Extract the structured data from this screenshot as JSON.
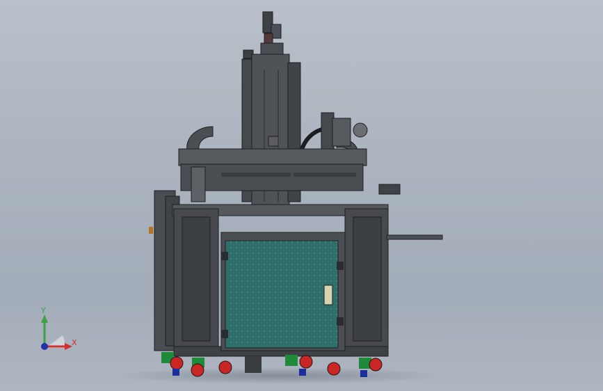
{
  "viewport": {
    "background_top": "#b9c0c9",
    "background_bottom": "#a2acb8"
  },
  "model": {
    "frame_color": "#4a4d52",
    "panel_color": "#2f6f6b",
    "caster_colors": [
      "#1f8a3a",
      "#c92626",
      "#1a2f9a"
    ]
  },
  "triad": {
    "x_label": "X",
    "y_label": "Y",
    "x_color": "#d23030",
    "y_color": "#3fa04a",
    "origin_color": "#2233aa"
  }
}
